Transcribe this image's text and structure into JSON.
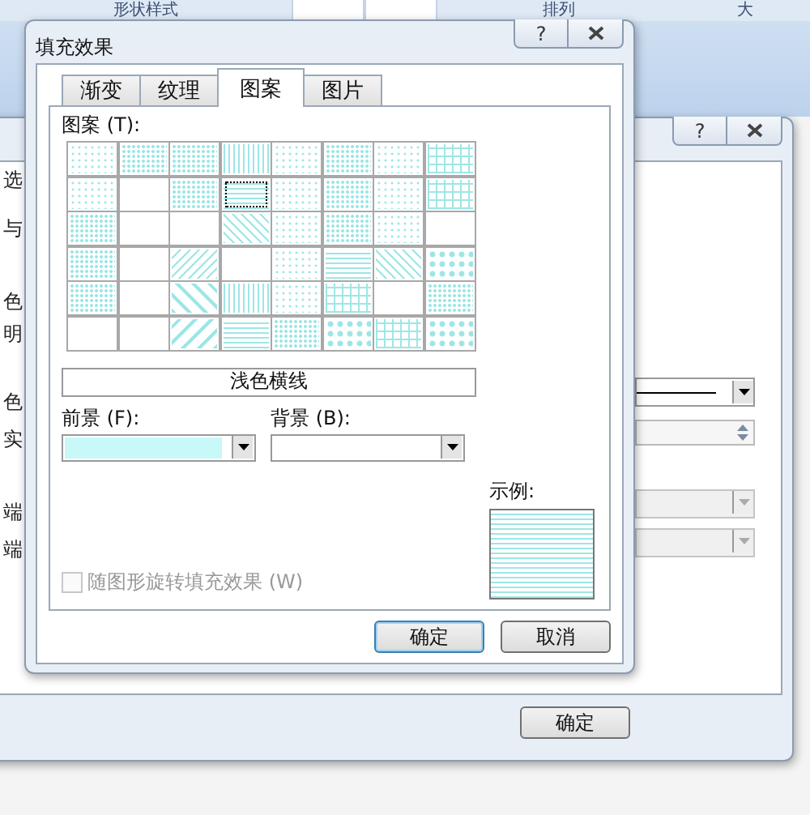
{
  "ribbon": {
    "groups": [
      "形状样式",
      "排列",
      "大"
    ]
  },
  "back_dialog": {
    "help": "?",
    "labels": [
      "选",
      "与",
      "色",
      "明",
      "色",
      "实",
      "端",
      "端"
    ],
    "footer_button": "确定"
  },
  "dialog": {
    "title": "填充效果",
    "help": "?",
    "tabs": [
      {
        "label": "渐变",
        "selected": false
      },
      {
        "label": "纹理",
        "selected": false
      },
      {
        "label": "图案",
        "selected": true
      },
      {
        "label": "图片",
        "selected": false
      }
    ],
    "pattern_label": "图案 (T):",
    "patterns": [
      {
        "kind": "sparse",
        "selected": false
      },
      {
        "kind": "dots",
        "selected": false
      },
      {
        "kind": "dots",
        "selected": false
      },
      {
        "kind": "vlines",
        "selected": false
      },
      {
        "kind": "sparse",
        "selected": false
      },
      {
        "kind": "dots",
        "selected": false
      },
      {
        "kind": "sparse",
        "selected": false
      },
      {
        "kind": "grid",
        "selected": false
      },
      {
        "kind": "sparse",
        "selected": false
      },
      {
        "kind": "dense",
        "selected": false
      },
      {
        "kind": "dots",
        "selected": false
      },
      {
        "kind": "hlines",
        "selected": true
      },
      {
        "kind": "sparse",
        "selected": false
      },
      {
        "kind": "dots",
        "selected": false
      },
      {
        "kind": "sparse",
        "selected": false
      },
      {
        "kind": "grid",
        "selected": false
      },
      {
        "kind": "dots",
        "selected": false
      },
      {
        "kind": "solid",
        "selected": false
      },
      {
        "kind": "dense",
        "selected": false
      },
      {
        "kind": "diag",
        "selected": false
      },
      {
        "kind": "sparse",
        "selected": false
      },
      {
        "kind": "dots",
        "selected": false
      },
      {
        "kind": "sparse",
        "selected": false
      },
      {
        "kind": "dense",
        "selected": false
      },
      {
        "kind": "dots",
        "selected": false
      },
      {
        "kind": "solid",
        "selected": false
      },
      {
        "kind": "rdiag",
        "selected": false
      },
      {
        "kind": "dense",
        "selected": false
      },
      {
        "kind": "sparse",
        "selected": false
      },
      {
        "kind": "hlines",
        "selected": false
      },
      {
        "kind": "diag",
        "selected": false
      },
      {
        "kind": "check",
        "selected": false
      },
      {
        "kind": "dots",
        "selected": false
      },
      {
        "kind": "solid",
        "selected": false
      },
      {
        "kind": "wdiag",
        "selected": false
      },
      {
        "kind": "vlines",
        "selected": false
      },
      {
        "kind": "sparse",
        "selected": false
      },
      {
        "kind": "grid",
        "selected": false
      },
      {
        "kind": "solid",
        "selected": false
      },
      {
        "kind": "dots",
        "selected": false
      },
      {
        "kind": "dense",
        "selected": false
      },
      {
        "kind": "solid",
        "selected": false
      },
      {
        "kind": "wrdiag",
        "selected": false
      },
      {
        "kind": "hlines",
        "selected": false
      },
      {
        "kind": "dots",
        "selected": false
      },
      {
        "kind": "check",
        "selected": false
      },
      {
        "kind": "grid",
        "selected": false
      },
      {
        "kind": "check",
        "selected": false
      }
    ],
    "pattern_name": "浅色横线",
    "foreground": {
      "label": "前景 (F):",
      "color": "#c8f8f8"
    },
    "background": {
      "label": "背景 (B):",
      "color": "#ffffff"
    },
    "sample_label": "示例:",
    "rotate_checkbox": {
      "label": "随图形旋转填充效果 (W)",
      "checked": false,
      "disabled": true
    },
    "buttons": [
      {
        "label": "确定",
        "default": true
      },
      {
        "label": "取消",
        "default": false
      }
    ]
  }
}
